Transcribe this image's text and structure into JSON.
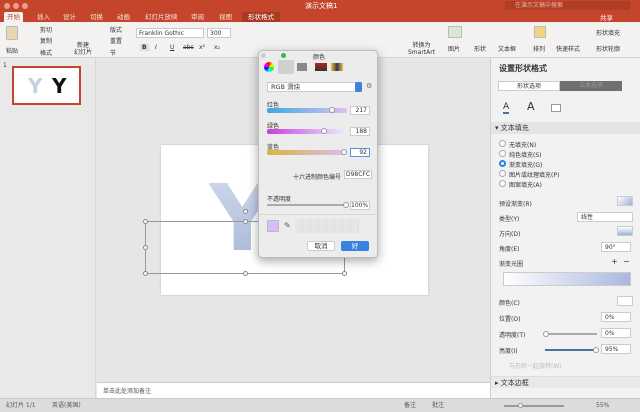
{
  "window": {
    "title": "演示文稿1",
    "search_placeholder": "在演示文稿中搜索",
    "share": "共享"
  },
  "tabs": [
    "开始",
    "插入",
    "设计",
    "切换",
    "动画",
    "幻灯片放映",
    "审阅",
    "视图",
    "形状格式"
  ],
  "ribbon": {
    "paste": "粘贴",
    "cut": "剪切",
    "copy": "复制",
    "format": "格式",
    "new_slide": "新建\n幻灯片",
    "layout": "版式",
    "reset": "重置",
    "section": "节",
    "font": "Franklin Gothic",
    "size": "300",
    "bold": "B",
    "italic": "I",
    "underline": "U",
    "strike": "abc",
    "super": "x²",
    "sub": "x₂",
    "convert_smartart": "转换为\nSmartArt",
    "picture": "图片",
    "shape": "形状",
    "textbox": "文本框",
    "arrange": "排列",
    "quick_styles": "快速样式",
    "shape_fill": "形状填充",
    "shape_outline": "形状轮廓"
  },
  "slides": {
    "number": "1",
    "letter": "Y"
  },
  "slide": {
    "letter": "Y"
  },
  "notes_placeholder": "单击此处添加备注",
  "status": {
    "slide": "幻灯片 1/1",
    "lang": "英语(美国)",
    "notes": "备注",
    "comments": "批注",
    "zoom": "55%"
  },
  "color_dialog": {
    "title": "颜色",
    "mode": "RGB 滑块",
    "red_label": "红色",
    "red": "217",
    "green_label": "绿色",
    "green": "188",
    "blue_label": "蓝色",
    "blue": "92",
    "hex_label": "十六进制颜色编号",
    "hex": "D98CFC",
    "opacity_label": "不透明度",
    "opacity": "100%",
    "cancel": "取消",
    "ok": "好",
    "swatch_color": "#d9bcfc"
  },
  "pane": {
    "title": "设置形状格式",
    "tab_shape": "形状选项",
    "tab_text": "文本选项",
    "section_fill": "文本填充",
    "fill_options": [
      "无填充(N)",
      "纯色填充(S)",
      "渐变填充(G)",
      "图片或纹理填充(P)",
      "图案填充(A)"
    ],
    "fill_selected": 2,
    "preset": "预设渐变(R)",
    "type_label": "类型(Y)",
    "type_value": "线性",
    "direction": "方向(D)",
    "angle_label": "角度(E)",
    "angle": "90°",
    "stops_label": "渐变光圈",
    "color_label": "颜色(C)",
    "position_label": "位置(O)",
    "position": "0%",
    "transparency_label": "透明度(T)",
    "transparency": "0%",
    "brightness_label": "亮度(I)",
    "brightness": "95%",
    "rotate_with_shape": "与形状一起旋转(W)",
    "section_border": "文本边框"
  }
}
